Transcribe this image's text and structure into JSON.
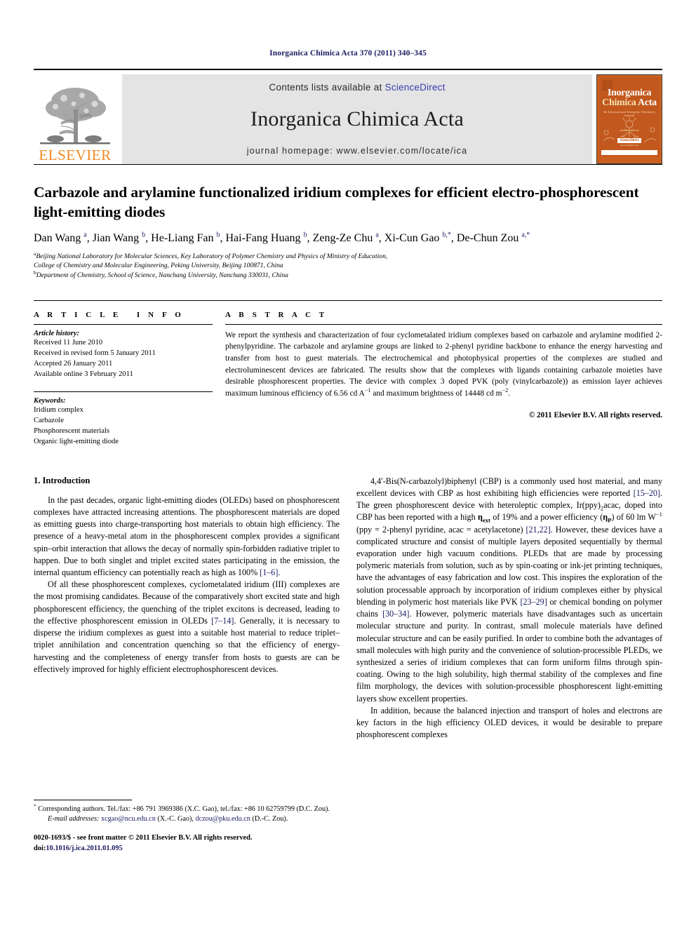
{
  "running_head": "Inorganica Chimica Acta 370 (2011) 340–345",
  "masthead": {
    "publisher_name": "ELSEVIER",
    "contents_text": "Contents lists available at",
    "sciencedirect": "ScienceDirect",
    "journal_title": "Inorganica Chimica Acta",
    "homepage": "journal homepage: www.elsevier.com/locate/ica",
    "cover": {
      "line1": "Inorganica",
      "line2": "Chimica",
      "line3": "Acta",
      "subtitle": "An International Inorganic Chemistry Journal",
      "sd_label": "available online at",
      "sd_box": "ScienceDirect",
      "sd_tiny": "www.sciencedirect.com"
    },
    "colors": {
      "link": "#3a3ab0",
      "elsevier_orange": "#f08a22",
      "cover_orange": "#c2581d",
      "band_gray": "#e4e4e4"
    }
  },
  "article": {
    "title": "Carbazole and arylamine functionalized iridium complexes for efficient electro-phosphorescent light-emitting diodes",
    "authors_html": "Dan Wang <sup>a</sup>, Jian Wang <sup>b</sup>, He-Liang Fan <sup>b</sup>, Hai-Fang Huang <sup>b</sup>, Zeng-Ze Chu <sup>a</sup>, Xi-Cun Gao <sup>b,*</sup>, De-Chun Zou <sup>a,*</sup>",
    "affiliations": [
      "<sup>a</sup>Beijing National Laboratory for Molecular Sciences, Key Laboratory of Polymer Chemistry and Physics of Ministry of Education,",
      "College of Chemistry and Molecular Engineering, Peking University, Beijing 100871, China",
      "<sup>b</sup>Department of Chemistry, School of Science, Nanchang University, Nanchang 330031, China"
    ]
  },
  "article_info": {
    "heading": "ARTICLE INFO",
    "history_label": "Article history:",
    "history": [
      "Received 11 June 2010",
      "Received in revised form 5 January 2011",
      "Accepted 26 January 2011",
      "Available online 3 February 2011"
    ],
    "keywords_label": "Keywords:",
    "keywords": [
      "Iridium complex",
      "Carbazole",
      "Phosphorescent materials",
      "Organic light-emitting diode"
    ]
  },
  "abstract": {
    "heading": "ABSTRACT",
    "body_html": "We report the synthesis and characterization of four cyclometalated iridium complexes based on carbazole and arylamine modified 2-phenylpyridine. The carbazole and arylamine groups are linked to 2-phenyl pyridine backbone to enhance the energy harvesting and transfer from host to guest materials. The electrochemical and photophysical properties of the complexes are studied and electroluminescent devices are fabricated. The results show that the complexes with ligands containing carbazole moieties have desirable phosphorescent properties. The device with complex 3 doped PVK (poly (vinylcarbazole)) as emission layer achieves maximum luminous efficiency of 6.56 cd A<sup>&minus;1</sup> and maximum brightness of 14448 cd m<sup>&minus;2</sup>.",
    "copyright": "© 2011 Elsevier B.V. All rights reserved."
  },
  "introduction": {
    "section_title": "1. Introduction",
    "left_paragraphs_html": [
      "In the past decades, organic light-emitting diodes (OLEDs) based on phosphorescent complexes have attracted increasing attentions. The phosphorescent materials are doped as emitting guests into charge-transporting host materials to obtain high efficiency. The presence of a heavy-metal atom in the phosphorescent complex provides a significant spin&ndash;orbit interaction that allows the decay of normally spin-forbidden radiative triplet to happen. Due to both singlet and triplet excited states participating in the emission, the internal quantum efficiency can potentially reach as high as 100% <span class=\"ref\">[1&ndash;6]</span>.",
      "Of all these phosphorescent complexes, cyclometalated iridium (III) complexes are the most promising candidates. Because of the comparatively short excited state and high phosphorescent efficiency, the quenching of the triplet excitons is decreased, leading to the effective phosphorescent emission in OLEDs <span class=\"ref\">[7&ndash;14]</span>. Generally, it is necessary to disperse the iridium complexes as guest into a suitable host material to reduce triplet&ndash;triplet annihilation and concentration quenching so that the efficiency of energy-harvesting and the completeness of energy transfer from hosts to guests are can be effectively improved for highly efficient electrophosphorescent devices."
    ],
    "right_paragraphs_html": [
      "4,4&prime;-Bis(N-carbazolyl)biphenyl (CBP) is a commonly used host material, and many excellent devices with CBP as host exhibiting high efficiencies were reported <span class=\"ref\">[15&ndash;20]</span>. The green phosphorescent device with heteroleptic complex, Ir(ppy)<sub>2</sub>acac, doped into CBP has been reported with a high <b>&eta;<sub>ext</sub></b> of 19% and a power efficiency (<b>&eta;<sub>P</sub></b>) of 60 lm W<sup>&minus;1</sup> (ppy = 2-phenyl pyridine, acac = acetylacetone) <span class=\"ref\">[21,22]</span>. However, these devices have a complicated structure and consist of multiple layers deposited sequentially by thermal evaporation under high vacuum conditions. PLEDs that are made by processing polymeric materials from solution, such as by spin-coating or ink-jet printing techniques, have the advantages of easy fabrication and low cost. This inspires the exploration of the solution processable approach by incorporation of iridium complexes either by physical blending in polymeric host materials like PVK <span class=\"ref\">[23&ndash;29]</span> or chemical bonding on polymer chains <span class=\"ref\">[30&ndash;34]</span>. However, polymeric materials have disadvantages such as uncertain molecular structure and purity. In contrast, small molecule materials have defined molecular structure and can be easily purified. In order to combine both the advantages of small molecules with high purity and the convenience of solution-processible PLEDs, we synthesized a series of iridium complexes that can form uniform films through spin-coating. Owing to the high solubility, high thermal stability of the complexes and fine film morphology, the devices with solution-processible phosphorescent light-emitting layers show excellent properties.",
      "In addition, because the balanced injection and transport of holes and electrons are key factors in the high efficiency OLED devices, it would be desirable to prepare phosphorescent complexes"
    ]
  },
  "footnotes": {
    "corresponding_html": "<sup>*</sup> Corresponding authors. Tel./fax: +86 791 3969386 (X.C. Gao), tel./fax: +86 10 62759799 (D.C. Zou).",
    "email_label": "E-mail addresses:",
    "email_html": "<span class=\"link\">xcgao@ncu.edu.cn</span> (X.-C. Gao), <span class=\"link\">dczou@pku.edu.cn</span> (D.-C. Zou).",
    "issn_line": "0020-1693/$ - see front matter © 2011 Elsevier B.V. All rights reserved.",
    "doi_label": "doi:",
    "doi_value": "10.1016/j.ica.2011.01.095"
  }
}
